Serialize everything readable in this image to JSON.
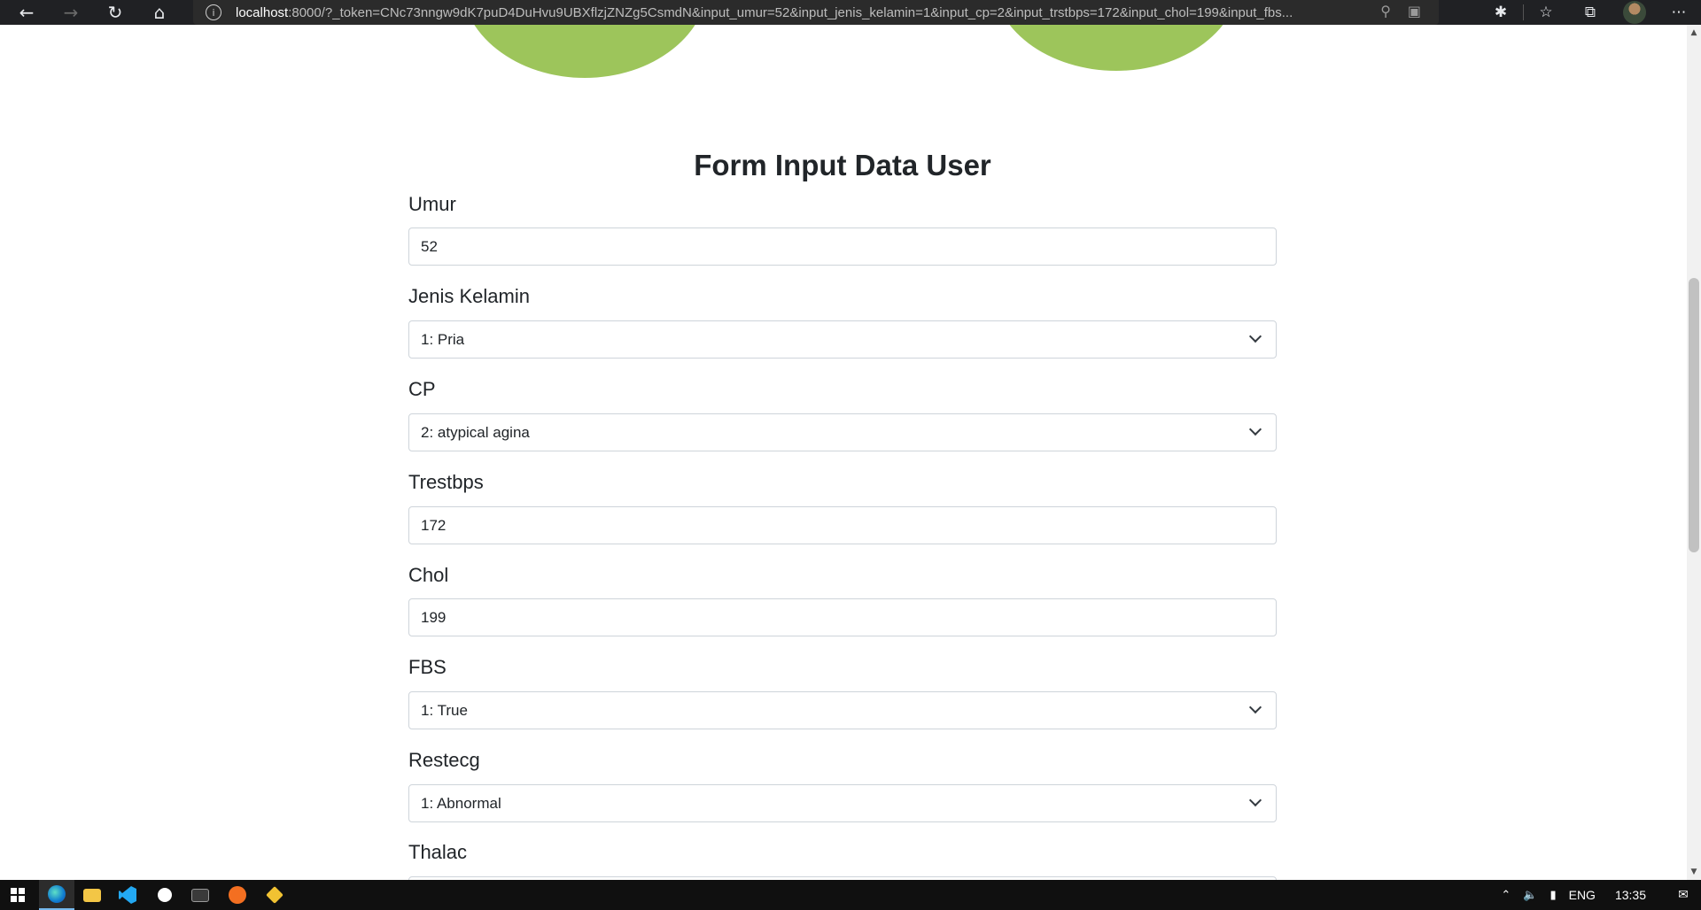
{
  "browser": {
    "url_host": "localhost",
    "url_rest": ":8000/?_token=CNc73nngw9dK7puD4DuHvu9UBXflzjZNZg5CsmdN&input_umur=52&input_jenis_kelamin=1&input_cp=2&input_trstbps=172&input_chol=199&input_fbs..."
  },
  "form": {
    "title": "Form Input Data User",
    "fields": [
      {
        "label": "Umur",
        "value": "52",
        "type": "text"
      },
      {
        "label": "Jenis Kelamin",
        "value": "1: Pria",
        "type": "select"
      },
      {
        "label": "CP",
        "value": "2: atypical agina",
        "type": "select"
      },
      {
        "label": "Trestbps",
        "value": "172",
        "type": "text"
      },
      {
        "label": "Chol",
        "value": "199",
        "type": "text"
      },
      {
        "label": "FBS",
        "value": "1: True",
        "type": "select"
      },
      {
        "label": "Restecg",
        "value": "1: Abnormal",
        "type": "select"
      },
      {
        "label": "Thalac",
        "value": "",
        "type": "text"
      }
    ]
  },
  "taskbar": {
    "language": "ENG",
    "time": "13:35"
  },
  "colors": {
    "accent_blob": "#9dc55b",
    "browser_bar": "#202124",
    "taskbar": "#101010"
  }
}
